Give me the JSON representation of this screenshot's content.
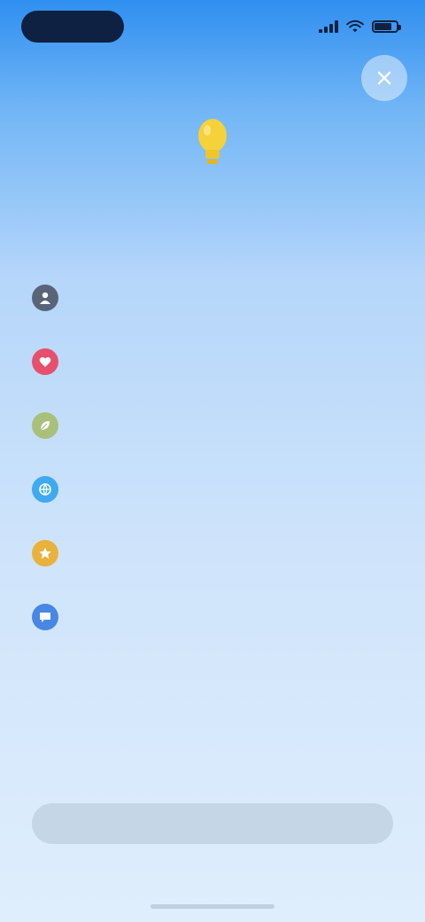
{
  "status_bar": {
    "time": "",
    "battery_level": 0.8
  },
  "header": {
    "title": "",
    "close_icon": "close-icon"
  },
  "hero": {
    "icon": "lightbulb-icon",
    "title": "",
    "subtitle": ""
  },
  "list": {
    "items": [
      {
        "label": "",
        "icon": "user-icon",
        "color": "#5a6478"
      },
      {
        "label": "",
        "icon": "heart-icon",
        "color": "#e7506d"
      },
      {
        "label": "",
        "icon": "leaf-icon",
        "color": "#a9c07a"
      },
      {
        "label": "",
        "icon": "globe-icon",
        "color": "#3fa9f1"
      },
      {
        "label": "",
        "icon": "star-icon",
        "color": "#e8b23c"
      },
      {
        "label": "",
        "icon": "chat-icon",
        "color": "#4a86e3"
      }
    ]
  },
  "footer": {
    "cta_label": "",
    "secondary_label": ""
  },
  "colors": {
    "accent": "#2846b8",
    "gradient_top": "#2f8ff0",
    "gradient_bottom": "#dfeefc",
    "hero_icon": "#f5d23a",
    "cta_background": "#c5d6e6"
  }
}
